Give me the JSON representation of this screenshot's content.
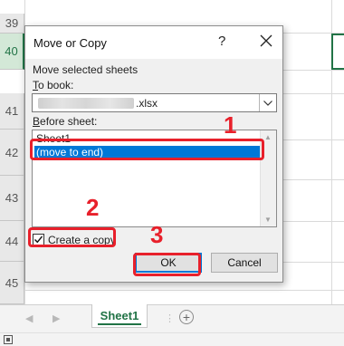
{
  "rows": [
    "39",
    "40",
    "41",
    "42",
    "43",
    "44",
    "45"
  ],
  "selected_row": "40",
  "sheet_tab": "Sheet1",
  "dialog": {
    "title": "Move or Copy",
    "help_glyph": "?",
    "move_label": "Move selected sheets",
    "to_book_prefix": "T",
    "to_book_rest": "o book:",
    "book_name_suffix": ".xlsx",
    "before_prefix": "B",
    "before_rest": "efore sheet:",
    "list_items": [
      "Sheet1",
      "(move to end)"
    ],
    "selected_item": "(move to end)",
    "checkbox_prefix": "C",
    "checkbox_rest": "reate a copy",
    "checkbox_checked": true,
    "ok_label": "OK",
    "cancel_label": "Cancel"
  },
  "annotations": {
    "n1": "1",
    "n2": "2",
    "n3": "3",
    "color": "#e8202b"
  },
  "colors": {
    "accent": "#217346",
    "selection": "#0078d7"
  }
}
